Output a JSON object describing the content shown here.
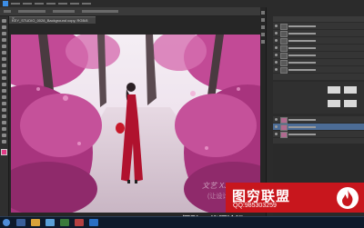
{
  "app": {
    "document_tab": "KEY_STUDIO_0028_Background copy, RGB/8",
    "document_tab_close": "×"
  },
  "watermarks": {
    "line1": "文艺 XJTDSJ  www.xjtdsj.com",
    "line2": "(让设计师交流的一个平台)"
  },
  "ad": {
    "title": "图穷联盟",
    "qq": "QQ:985303259"
  },
  "site_footer": "摄影CG资源论坛  www.xjtdsj.com",
  "colors": {
    "accent_red": "#c8161d",
    "selection_blue": "#4c6c96"
  }
}
